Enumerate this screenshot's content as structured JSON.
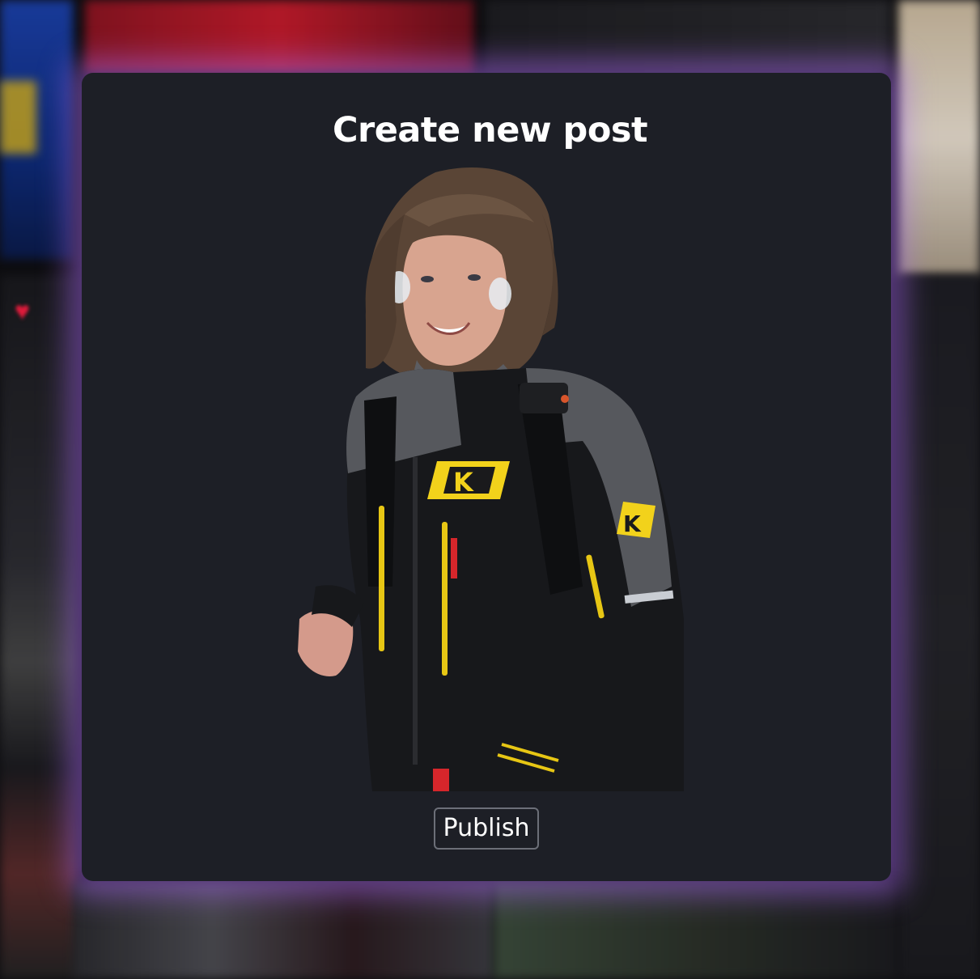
{
  "modal": {
    "title": "Create new post",
    "publish_label": "Publish"
  },
  "photo": {
    "subject": "smiling person in black and grey snowmobile jacket with yellow K logo",
    "icon": "uploaded-photo"
  },
  "colors": {
    "modal_background": "#1d1f26",
    "modal_glow": "#a064e6",
    "button_border": "#6c6f78",
    "title_text": "#ffffff",
    "jacket_accent": "#f2d21b"
  },
  "background": {
    "icons": [
      "heart-icon"
    ]
  }
}
